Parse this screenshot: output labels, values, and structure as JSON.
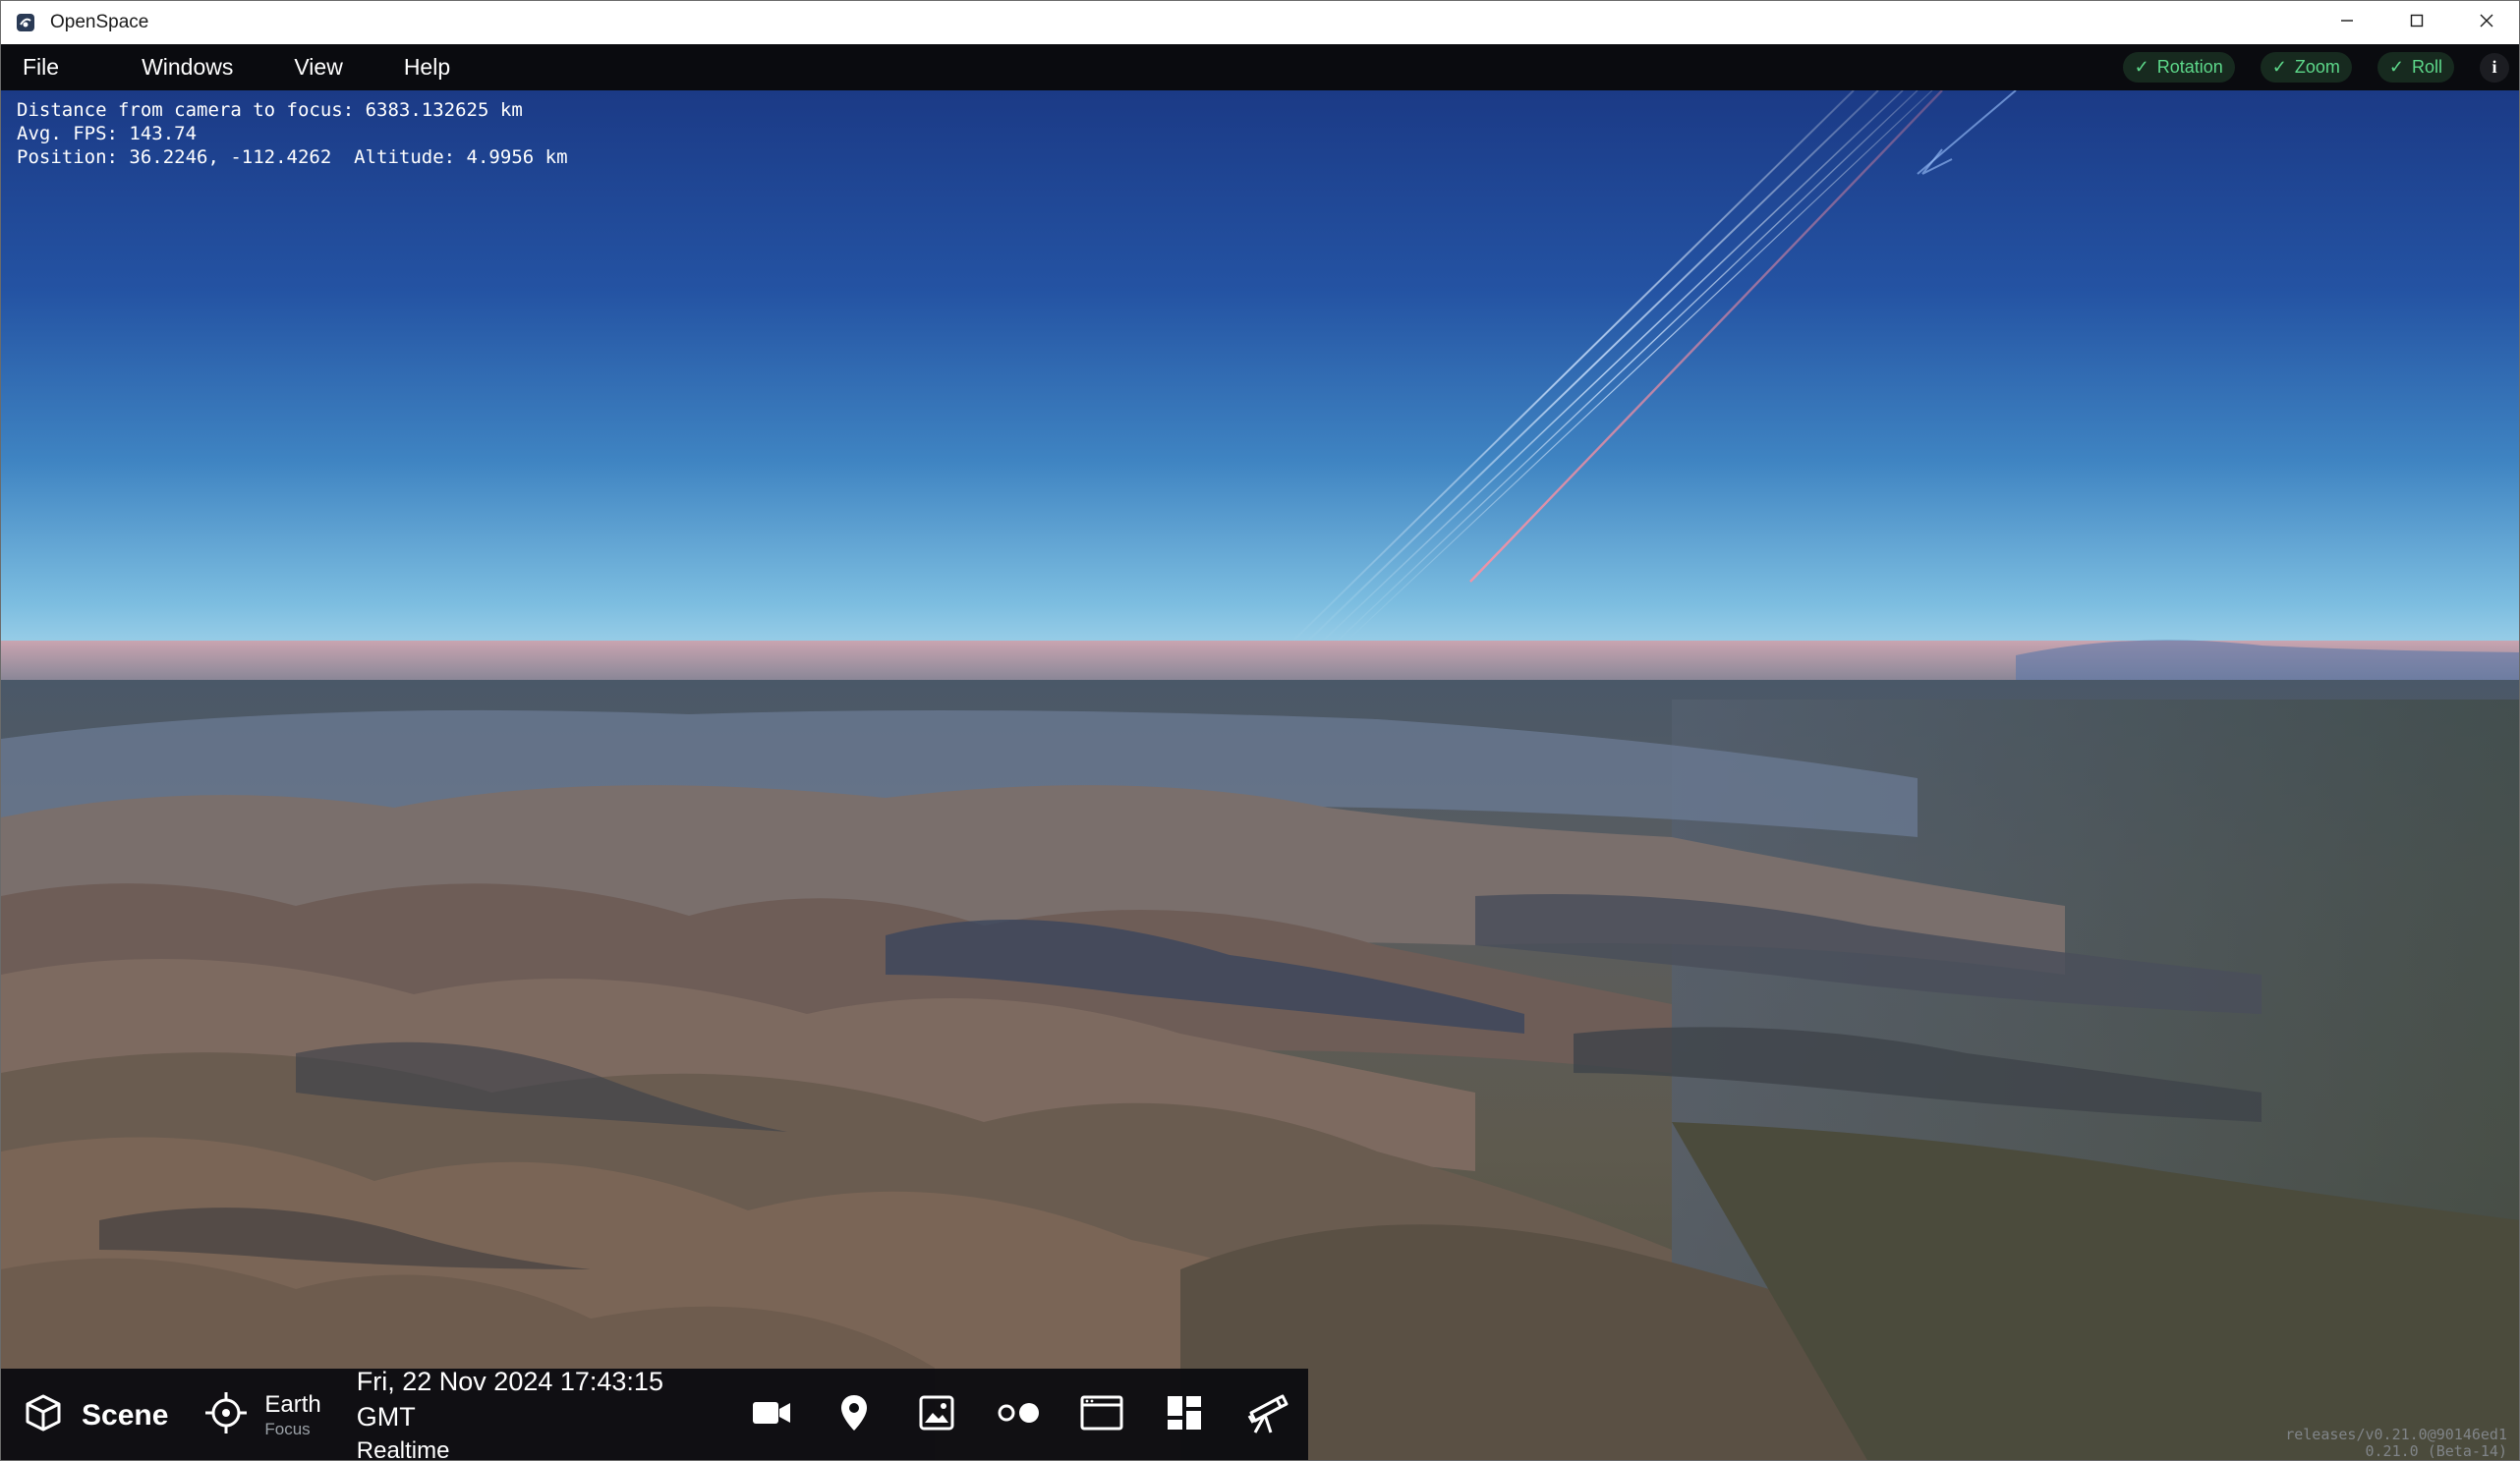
{
  "window": {
    "title": "OpenSpace",
    "icon": "openspace-logo-icon",
    "controls": [
      "minimize-icon",
      "maximize-icon",
      "close-icon"
    ]
  },
  "menubar": {
    "items": [
      {
        "label": "File"
      },
      {
        "label": "Windows"
      },
      {
        "label": "View"
      },
      {
        "label": "Help"
      }
    ],
    "toggles": [
      {
        "label": "Rotation",
        "checked": true
      },
      {
        "label": "Zoom",
        "checked": true
      },
      {
        "label": "Roll",
        "checked": true
      }
    ],
    "info_label": "i",
    "toggle_color": "#5dd88a"
  },
  "stats": {
    "distance": "Distance from camera to focus: 6383.132625 km",
    "fps": "Avg. FPS: 143.74",
    "position": "Position: 36.2246, -112.4262  Altitude: 4.9956 km"
  },
  "version": {
    "line1": "releases/v0.21.0@90146ed1",
    "line2": "0.21.0 (Beta-14)"
  },
  "bottombar": {
    "scene_label": "Scene",
    "focus_name": "Earth",
    "focus_sub": "Focus",
    "date": "Fri, 22 Nov 2024 17:43:15 GMT",
    "time_mode": "Realtime",
    "tools": [
      "camera-icon",
      "location-pin-icon",
      "image-icon",
      "dots-icon",
      "browser-window-icon",
      "dashboard-icon",
      "telescope-icon"
    ]
  },
  "colors": {
    "sky_top": "#1d3f8c",
    "sky_horizon": "#8cc7e4",
    "menubar_bg": "#0a0b0f",
    "bottombar_bg": "#0c0d11"
  }
}
